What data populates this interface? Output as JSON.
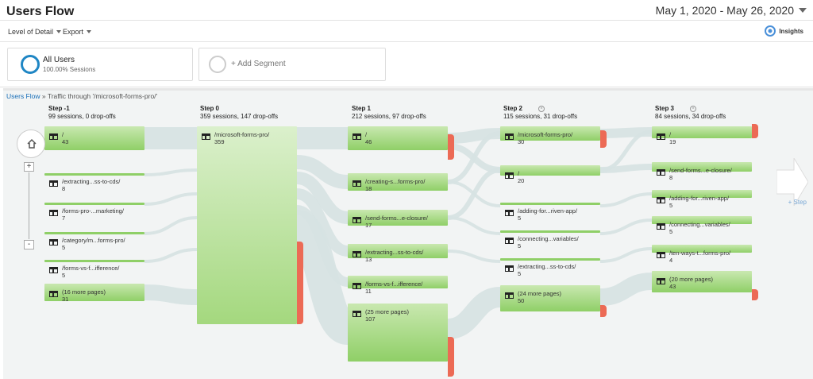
{
  "header": {
    "title": "Users Flow",
    "date_range": "May 1, 2020 - May 26, 2020"
  },
  "toolbar": {
    "level_of_detail": "Level of Detail",
    "export": "Export",
    "insights": "Insights"
  },
  "segments": {
    "all_users": {
      "name": "All Users",
      "subtitle": "100.00% Sessions"
    },
    "add": "+ Add Segment"
  },
  "flow": {
    "breadcrumb_link": "Users Flow",
    "breadcrumb_rest": " » Traffic through '/microsoft-forms-pro/'",
    "steps": [
      {
        "name": "Step -1",
        "stats": "99 sessions, 0 drop-offs"
      },
      {
        "name": "Step 0",
        "stats": "359 sessions, 147 drop-offs"
      },
      {
        "name": "Step 1",
        "stats": "212 sessions, 97 drop-offs"
      },
      {
        "name": "Step 2",
        "stats": "115 sessions, 31 drop-offs"
      },
      {
        "name": "Step 3",
        "stats": "84 sessions, 34 drop-offs"
      }
    ],
    "add_step": "+ Step",
    "nodes": {
      "s_1": [
        {
          "label": "/",
          "count": "43"
        },
        {
          "label": "/extracting...ss-to-cds/",
          "count": "8"
        },
        {
          "label": "/forms-pro-...marketing/",
          "count": "7"
        },
        {
          "label": "/category/m...forms-pro/",
          "count": "5"
        },
        {
          "label": "/forms-vs-f...ifference/",
          "count": "5"
        },
        {
          "label": "(16 more pages)",
          "count": "31"
        }
      ],
      "s0": [
        {
          "label": "/microsoft-forms-pro/",
          "count": "359"
        }
      ],
      "s1": [
        {
          "label": "/",
          "count": "46"
        },
        {
          "label": "/creating-s...forms-pro/",
          "count": "18"
        },
        {
          "label": "/send-forms...e-closure/",
          "count": "17"
        },
        {
          "label": "/extracting...ss-to-cds/",
          "count": "13"
        },
        {
          "label": "/forms-vs-f...ifference/",
          "count": "11"
        },
        {
          "label": "(25 more pages)",
          "count": "107"
        }
      ],
      "s2": [
        {
          "label": "/microsoft-forms-pro/",
          "count": "30"
        },
        {
          "label": "/",
          "count": "20"
        },
        {
          "label": "/adding-for...riven-app/",
          "count": "5"
        },
        {
          "label": "/connecting...variables/",
          "count": "5"
        },
        {
          "label": "/extracting...ss-to-cds/",
          "count": "5"
        },
        {
          "label": "(24 more pages)",
          "count": "50"
        }
      ],
      "s3": [
        {
          "label": "/",
          "count": "19"
        },
        {
          "label": "/send-forms...e-closure/",
          "count": "8"
        },
        {
          "label": "/adding-for...riven-app/",
          "count": "5"
        },
        {
          "label": "/connecting...variables/",
          "count": "5"
        },
        {
          "label": "/ten-ways-t...forms-pro/",
          "count": "4"
        },
        {
          "label": "(20 more pages)",
          "count": "43"
        }
      ]
    }
  },
  "colors": {
    "accent": "#1f86c4",
    "node": "#8fcf67",
    "dropoff": "#ec6a55",
    "link": "#d6e2e2"
  }
}
